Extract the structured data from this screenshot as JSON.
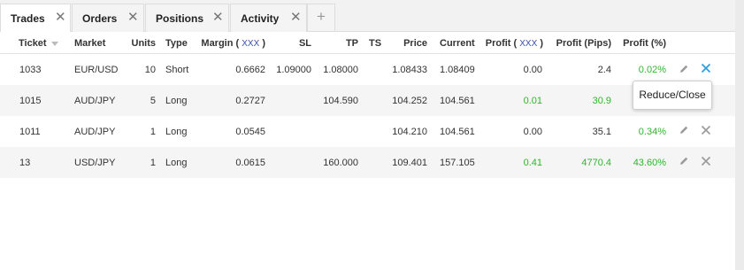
{
  "tabs": [
    {
      "label": "Trades",
      "active": true
    },
    {
      "label": "Orders",
      "active": false
    },
    {
      "label": "Positions",
      "active": false
    },
    {
      "label": "Activity",
      "active": false
    }
  ],
  "close_glyph": "✕",
  "add_tab_glyph": "+",
  "table": {
    "columns": {
      "ticket": "Ticket",
      "market": "Market",
      "units": "Units",
      "type": "Type",
      "margin": "Margin",
      "margin_unit": "XXX",
      "sl": "SL",
      "tp": "TP",
      "ts": "TS",
      "price": "Price",
      "current": "Current",
      "profit": "Profit",
      "profit_unit": "XXX",
      "profit_pips": "Profit (Pips)",
      "profit_pct": "Profit (%)"
    },
    "rows": [
      {
        "ticket": "1033",
        "market": "EUR/USD",
        "units": "10",
        "type": "Short",
        "margin": "0.6662",
        "sl": "1.09000",
        "tp": "1.08000",
        "ts": "",
        "price": "1.08433",
        "current": "1.08409",
        "profit": "0.00",
        "profit_pips": "2.4",
        "profit_pct": "0.02%",
        "close_active": true
      },
      {
        "ticket": "1015",
        "market": "AUD/JPY",
        "units": "5",
        "type": "Long",
        "margin": "0.2727",
        "sl": "",
        "tp": "104.590",
        "ts": "",
        "price": "104.252",
        "current": "104.561",
        "profit": "0.01",
        "profit_pips": "30.9",
        "profit_pct": "",
        "close_active": false
      },
      {
        "ticket": "1011",
        "market": "AUD/JPY",
        "units": "1",
        "type": "Long",
        "margin": "0.0545",
        "sl": "",
        "tp": "",
        "ts": "",
        "price": "104.210",
        "current": "104.561",
        "profit": "0.00",
        "profit_pips": "35.1",
        "profit_pct": "0.34%",
        "close_active": false
      },
      {
        "ticket": "13",
        "market": "USD/JPY",
        "units": "1",
        "type": "Long",
        "margin": "0.0615",
        "sl": "",
        "tp": "160.000",
        "ts": "",
        "price": "109.401",
        "current": "157.105",
        "profit": "0.41",
        "profit_pips": "4770.4",
        "profit_pct": "43.60%",
        "close_active": false
      }
    ]
  },
  "tooltip": {
    "text": "Reduce/Close"
  },
  "colors": {
    "positive": "#2fb52f",
    "close_active": "#2f9ee0",
    "icon_muted": "#9a9a9a",
    "unit_link": "#3850a8"
  },
  "icons": {
    "edit": "pencil-icon",
    "close": "close-icon",
    "sort": "sort-down-icon",
    "add": "plus-icon"
  }
}
